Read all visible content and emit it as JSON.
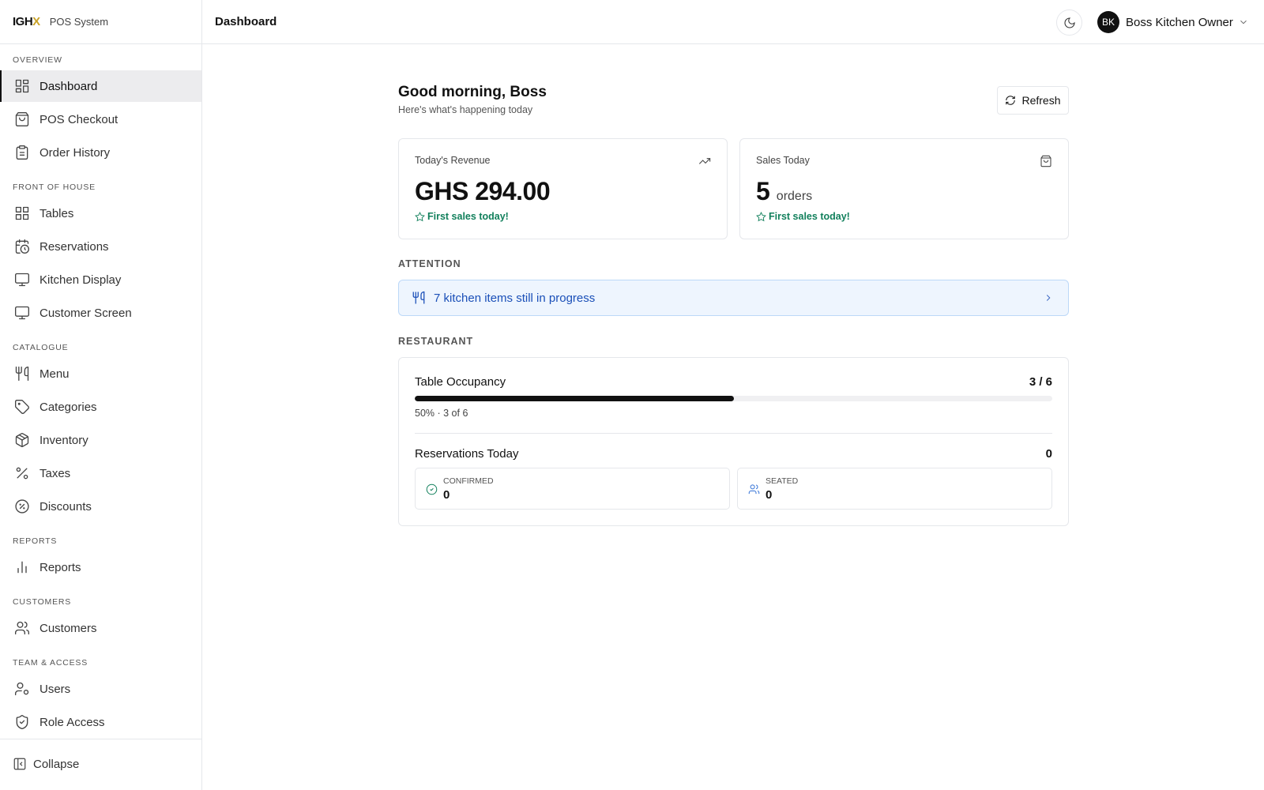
{
  "brand": {
    "logo_main": "IGH",
    "logo_x": "X",
    "subtitle": "POS System"
  },
  "header": {
    "title": "Dashboard",
    "user_initials": "BK",
    "user_name": "Boss Kitchen Owner"
  },
  "sidebar": {
    "sections": [
      {
        "label": "OVERVIEW",
        "items": [
          {
            "label": "Dashboard",
            "icon": "dashboard-icon",
            "active": true
          },
          {
            "label": "POS Checkout",
            "icon": "shopping-bag-icon"
          },
          {
            "label": "Order History",
            "icon": "clipboard-icon"
          }
        ]
      },
      {
        "label": "FRONT OF HOUSE",
        "items": [
          {
            "label": "Tables",
            "icon": "grid-icon"
          },
          {
            "label": "Reservations",
            "icon": "calendar-clock-icon"
          },
          {
            "label": "Kitchen Display",
            "icon": "monitor-icon"
          },
          {
            "label": "Customer Screen",
            "icon": "monitor-icon"
          }
        ]
      },
      {
        "label": "CATALOGUE",
        "items": [
          {
            "label": "Menu",
            "icon": "utensils-icon"
          },
          {
            "label": "Categories",
            "icon": "tag-icon"
          },
          {
            "label": "Inventory",
            "icon": "package-icon"
          },
          {
            "label": "Taxes",
            "icon": "percent-icon"
          },
          {
            "label": "Discounts",
            "icon": "discount-badge-icon"
          }
        ]
      },
      {
        "label": "REPORTS",
        "items": [
          {
            "label": "Reports",
            "icon": "bar-chart-icon"
          }
        ]
      },
      {
        "label": "CUSTOMERS",
        "items": [
          {
            "label": "Customers",
            "icon": "users-icon"
          }
        ]
      },
      {
        "label": "TEAM & ACCESS",
        "items": [
          {
            "label": "Users",
            "icon": "user-cog-icon"
          },
          {
            "label": "Role Access",
            "icon": "shield-check-icon"
          }
        ]
      }
    ],
    "collapse_label": "Collapse"
  },
  "main": {
    "greeting": "Good morning, Boss",
    "subtitle": "Here's what's happening today",
    "refresh_label": "Refresh",
    "revenue": {
      "label": "Today's Revenue",
      "value": "GHS 294.00",
      "note": "First sales today!"
    },
    "sales": {
      "label": "Sales Today",
      "value": "5",
      "unit": "orders",
      "note": "First sales today!"
    },
    "attention": {
      "title": "ATTENTION",
      "alert_text": "7 kitchen items still in progress"
    },
    "restaurant": {
      "title": "RESTAURANT",
      "occupancy": {
        "label": "Table Occupancy",
        "count": "3 / 6",
        "percent": 50,
        "detail": "50% · 3 of 6"
      },
      "reservations": {
        "label": "Reservations Today",
        "count": "0",
        "confirmed": {
          "label": "Confirmed",
          "value": "0"
        },
        "seated": {
          "label": "Seated",
          "value": "0"
        }
      }
    }
  },
  "colors": {
    "accent_green": "#12805c",
    "alert_blue": "#1a4fb8",
    "alert_bg": "#eef5fe",
    "logo_accent": "#c9a227"
  }
}
